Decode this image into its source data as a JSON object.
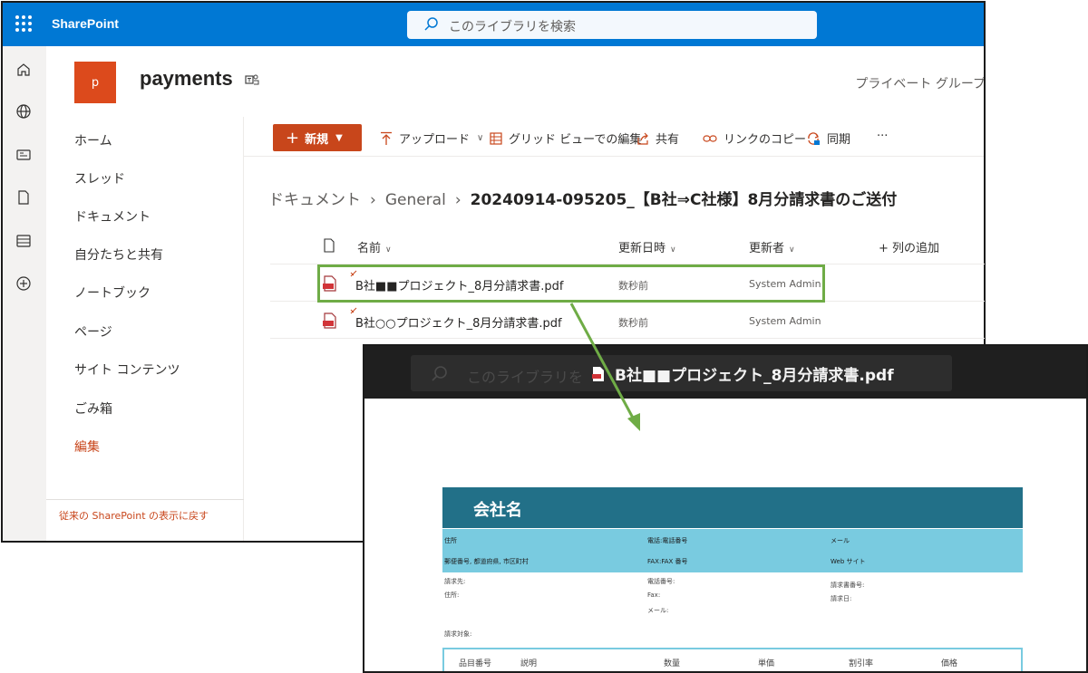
{
  "suite": {
    "brand": "SharePoint",
    "search_placeholder": "このライブラリを検索"
  },
  "site": {
    "logo_letter": "p",
    "title": "payments",
    "privacy": "プライベート グループ"
  },
  "nav": {
    "items": [
      "ホーム",
      "スレッド",
      "ドキュメント",
      "自分たちと共有",
      "ノートブック",
      "ページ",
      "サイト コンテンツ",
      "ごみ箱"
    ],
    "edit": "編集",
    "footer": "従来の SharePoint の表示に戻す"
  },
  "commands": {
    "new": "新規",
    "upload": "アップロード",
    "grid_edit": "グリッド ビューでの編集",
    "share": "共有",
    "copy_link": "リンクのコピー",
    "sync": "同期",
    "more": "···"
  },
  "breadcrumb": {
    "root": "ドキュメント",
    "folder": "General",
    "current": "20240914-095205_【B社⇒C社様】8月分請求書のご送付"
  },
  "list": {
    "columns": {
      "name": "名前",
      "modified": "更新日時",
      "modified_by": "更新者",
      "add_column": "+ 列の追加"
    },
    "rows": [
      {
        "name": "B社■■プロジェクト_8月分請求書.pdf",
        "modified": "数秒前",
        "modified_by": "System Admin"
      },
      {
        "name": "B社○○プロジェクト_8月分請求書.pdf",
        "modified": "数秒前",
        "modified_by": "System Admin"
      }
    ]
  },
  "viewer": {
    "search_placeholder": "このライブラリを",
    "file_title": "B社■■プロジェクト_8月分請求書.pdf",
    "doc": {
      "company": "会社名",
      "info": {
        "address": "住所",
        "phone": "電話:電話番号",
        "email": "メール",
        "postal": "郵便番号, 都道府県, 市区町村",
        "fax": "FAX:FAX 番号",
        "web": "Web サイト"
      },
      "billing": {
        "bill_to": "請求先:",
        "address": "住所:",
        "phone": "電話番号:",
        "fax": "Fax:",
        "mail": "メール:",
        "invoice_no": "請求書番号:",
        "invoice_date": "請求日:",
        "target": "請求対象:"
      },
      "table_headers": [
        "品目番号",
        "説明",
        "数量",
        "単価",
        "割引率",
        "価格"
      ]
    }
  },
  "colors": {
    "suite_blue": "#0078d4",
    "accent_orange": "#c8461b",
    "highlight_green": "#6fac46",
    "doc_teal": "#227088",
    "doc_light_blue": "#79cbe0"
  }
}
